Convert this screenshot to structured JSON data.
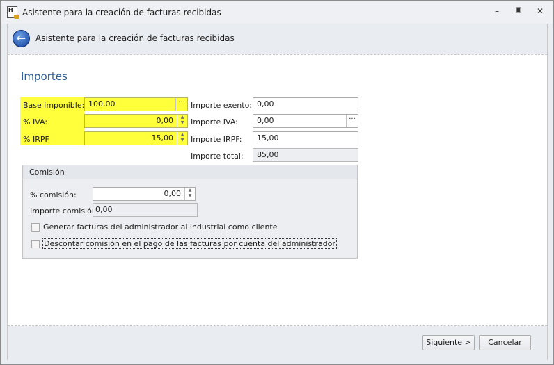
{
  "window": {
    "title": "Asistente para la creación de facturas recibidas",
    "minimize": "–",
    "restore": "▣",
    "close": "✕",
    "icon_text": "H"
  },
  "header": {
    "title": "Asistente para la creación de facturas recibidas"
  },
  "section": {
    "title": "Importes"
  },
  "fields": {
    "base_imponible": {
      "label": "Base imponible:",
      "value": "100,00"
    },
    "iva_pct": {
      "label": "% IVA:",
      "value": "0,00"
    },
    "irpf_pct": {
      "label": "% IRPF",
      "value": "15,00"
    },
    "importe_exento": {
      "label": "Importe exento:",
      "value": "0,00"
    },
    "importe_iva": {
      "label": "Importe IVA:",
      "value": "0,00"
    },
    "importe_irpf": {
      "label": "Importe IRPF:",
      "value": "15,00"
    },
    "importe_total": {
      "label": "Importe total:",
      "value": "85,00"
    }
  },
  "comision": {
    "title": "Comisión",
    "pct": {
      "label": "% comisión:",
      "value": "0,00"
    },
    "importe": {
      "label": "Importe comisión:",
      "value": "0,00"
    },
    "check1": {
      "label": "Generar facturas del administrador al industrial como cliente",
      "checked": false
    },
    "check2": {
      "label": "Descontar comisión en el pago de las facturas por cuenta del administrador",
      "checked": false
    }
  },
  "footer": {
    "next_first": "S",
    "next_rest": "iguiente >",
    "cancel": "Cancelar"
  },
  "colors": {
    "highlight": "#ffff3c",
    "section_title": "#2a5d9a"
  }
}
